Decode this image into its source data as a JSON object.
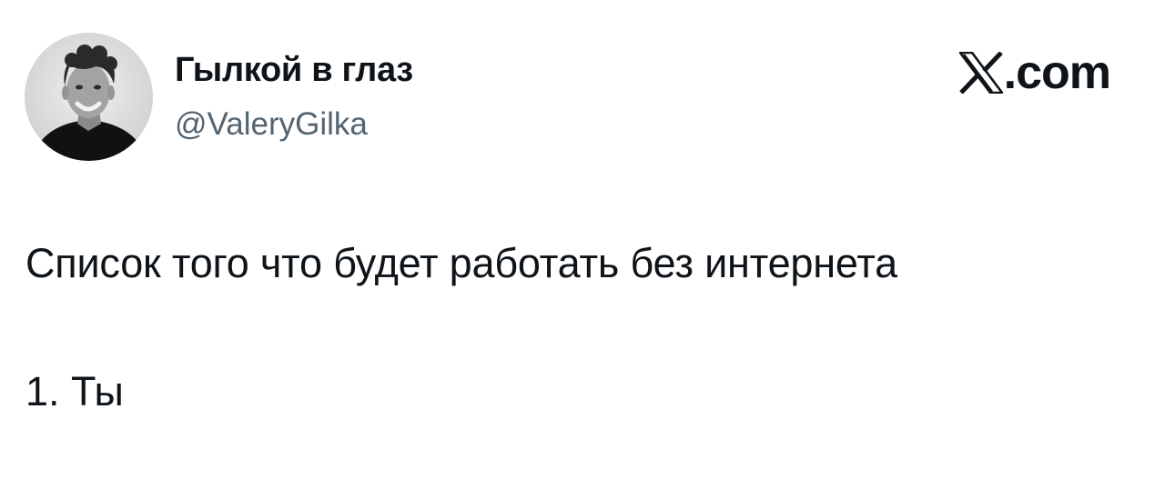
{
  "author": {
    "display_name": "Гылкой в глаз",
    "handle": "@ValeryGilka",
    "avatar_icon": "profile-photo"
  },
  "brand": {
    "logo_icon": "x-logo-icon",
    "suffix": ".com"
  },
  "tweet": {
    "text": "Список того что будет работать без интернета",
    "list_item": "1. Ты"
  },
  "colors": {
    "text_primary": "#0f1419",
    "text_secondary": "#536471",
    "background": "#ffffff"
  }
}
